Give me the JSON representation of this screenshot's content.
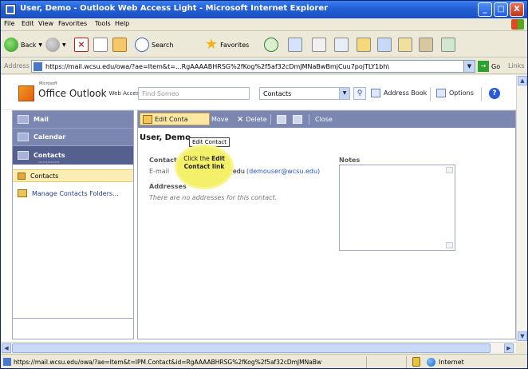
{
  "window": {
    "title": "User, Demo - Outlook Web Access Light - Microsoft Internet Explorer",
    "controls": {
      "minimize": "_",
      "maximize": "□",
      "close": "X"
    }
  },
  "menu": [
    "File",
    "Edit",
    "View",
    "Favorites",
    "Tools",
    "Help"
  ],
  "toolbar": {
    "back": "Back",
    "search": "Search",
    "favorites": "Favorites"
  },
  "address_bar": {
    "label": "Address",
    "url": "https://mail.wcsu.edu/owa/?ae=Item&t=...RgAAAABHRSG%2fKog%2f5af32cDmJMNaBwBmjCuu7pojTLY1bh\\",
    "go": "Go",
    "links": "Links"
  },
  "owa": {
    "logo_ms": "Microsoft",
    "logo_name": "Office Outlook",
    "logo_sub": "Web Access",
    "find_placeholder": "Find Someo",
    "folder_select": "Contacts",
    "address_book": "Address Book",
    "options": "Options",
    "help": "?"
  },
  "nav": {
    "mail": "Mail",
    "calendar": "Calendar",
    "contacts": "Contacts",
    "folder_contacts": "Contacts",
    "manage_folders": "Manage Contacts Folders..."
  },
  "actions": {
    "edit": "Edit Conta",
    "move": "Move",
    "delete": "Delete",
    "close": "Close"
  },
  "contact": {
    "name": "User, Demo",
    "tooltip": "Edit Contact",
    "section_contact": "Contact",
    "email_label": "E-mail",
    "email_value": "demouser@wcsu.edu",
    "email_display": "(demouser@wcsu.edu)",
    "section_addresses": "Addresses",
    "no_addresses": "There are no addresses for this contact.",
    "section_notes": "Notes"
  },
  "callout": {
    "line1_prefix": "Click the ",
    "line1_bold": "Edit",
    "line2": "Contact link"
  },
  "status": {
    "text": "https://mail.wcsu.edu/owa/?ae=Item&t=IPM.Contact&id=RgAAAABHRSG%2fKog%2f5af32cDmJMNaBw",
    "zone": "Internet"
  }
}
